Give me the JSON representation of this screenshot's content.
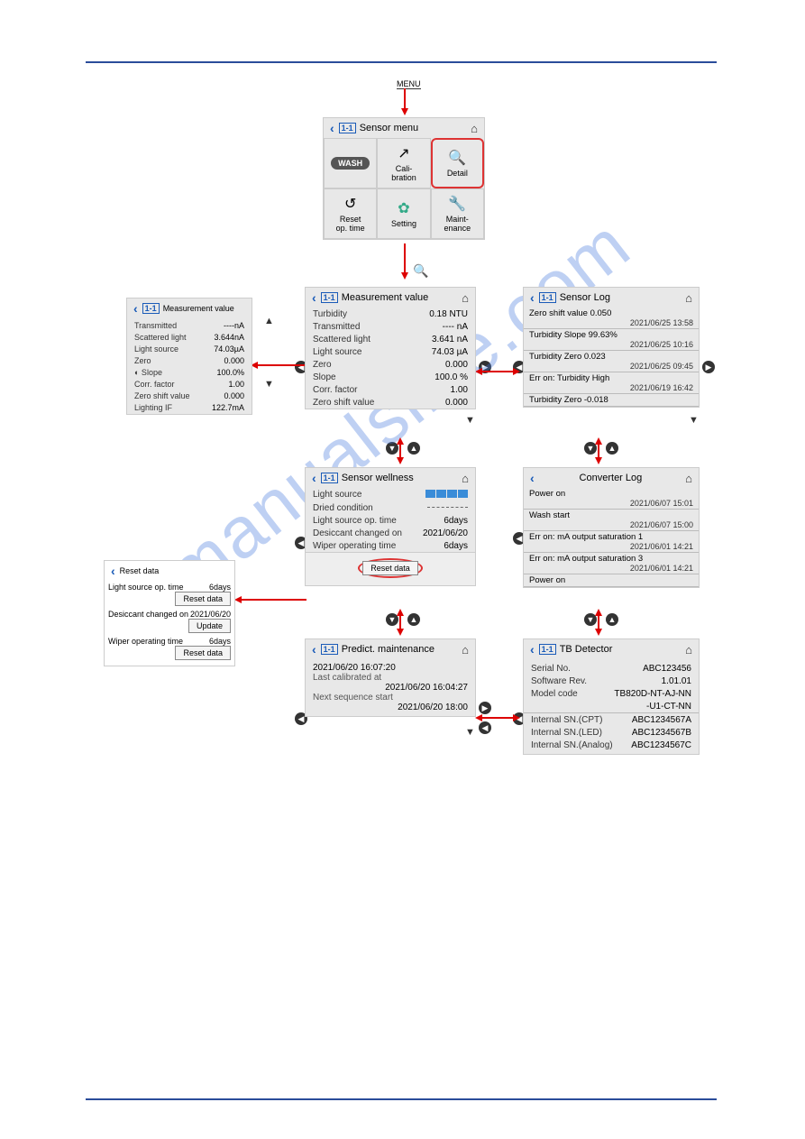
{
  "watermark": "manualslive.com",
  "menu_label": "MENU",
  "panels": {
    "sensor_menu": {
      "tag": "1-1",
      "title": "Sensor menu",
      "cells": [
        "WASH",
        "Cali-\nbration",
        "Detail",
        "Reset\nop. time",
        "Setting",
        "Maint-\nenance"
      ]
    },
    "meas_small": {
      "tag": "1-1",
      "title": "Measurement value",
      "rows": [
        {
          "k": "Transmitted",
          "v": "----nA"
        },
        {
          "k": "Scattered light",
          "v": "3.644nA"
        },
        {
          "k": "Light source",
          "v": "74.03µA"
        },
        {
          "k": "Zero",
          "v": "0.000"
        },
        {
          "k": "Slope",
          "v": "100.0%"
        },
        {
          "k": "Corr. factor",
          "v": "1.00"
        },
        {
          "k": "Zero shift value",
          "v": "0.000"
        },
        {
          "k": "Lighting IF",
          "v": "122.7mA"
        }
      ]
    },
    "meas": {
      "tag": "1-1",
      "title": "Measurement value",
      "rows": [
        {
          "k": "Turbidity",
          "v": "0.18 NTU"
        },
        {
          "k": "Transmitted",
          "v": "---- nA"
        },
        {
          "k": "Scattered light",
          "v": "3.641 nA"
        },
        {
          "k": "Light source",
          "v": "74.03 µA"
        },
        {
          "k": "Zero",
          "v": "0.000"
        },
        {
          "k": "Slope",
          "v": "100.0 %"
        },
        {
          "k": "Corr. factor",
          "v": "1.00"
        },
        {
          "k": "Zero shift value",
          "v": "0.000"
        }
      ]
    },
    "sensor_log": {
      "tag": "1-1",
      "title": "Sensor Log",
      "entries": [
        {
          "t": "Zero shift value 0.050",
          "d": "2021/06/25 13:58"
        },
        {
          "t": "Turbidity Slope 99.63%",
          "d": "2021/06/25 10:16"
        },
        {
          "t": "Turbidity Zero 0.023",
          "d": "2021/06/25 09:45"
        },
        {
          "t": "Err on: Turbidity High",
          "d": "2021/06/19 16:42"
        },
        {
          "t": "Turbidity Zero -0.018",
          "d": ""
        }
      ]
    },
    "wellness": {
      "tag": "1-1",
      "title": "Sensor wellness",
      "rows": [
        {
          "k": "Light source",
          "v": "BARS"
        },
        {
          "k": "Dried condition",
          "v": "DASH"
        },
        {
          "k": "Light source op. time",
          "v": "6days"
        },
        {
          "k": "Desiccant changed on",
          "v": "2021/06/20"
        },
        {
          "k": "Wiper operating time",
          "v": "6days"
        }
      ],
      "reset": "Reset data"
    },
    "converter_log": {
      "title": "Converter Log",
      "entries": [
        {
          "t": "Power on",
          "d": "2021/06/07 15:01"
        },
        {
          "t": "Wash start",
          "d": "2021/06/07 15:00"
        },
        {
          "t": "Err on: mA output saturation 1",
          "d": "2021/06/01 14:21"
        },
        {
          "t": "Err on: mA output saturation 3",
          "d": "2021/06/01 14:21"
        },
        {
          "t": "Power on",
          "d": ""
        }
      ]
    },
    "reset_data": {
      "title": "Reset data",
      "rows": [
        {
          "k": "Light source op. time",
          "v": "6days",
          "btn": "Reset data"
        },
        {
          "k": "Desiccant changed on",
          "v": "2021/06/20",
          "btn": "Update"
        },
        {
          "k": "Wiper operating time",
          "v": "6days",
          "btn": "Reset data"
        }
      ]
    },
    "predict": {
      "tag": "1-1",
      "title": "Predict. maintenance",
      "lines": [
        "2021/06/20 16:07:20",
        "Last calibrated at",
        "2021/06/20 16:04:27",
        "Next sequence start",
        "2021/06/20 18:00"
      ]
    },
    "tb_detector": {
      "tag": "1-1",
      "title": "TB Detector",
      "rows": [
        {
          "k": "Serial No.",
          "v": "ABC123456"
        },
        {
          "k": "Software Rev.",
          "v": "1.01.01"
        },
        {
          "k": "Model code",
          "v": "TB820D-NT-AJ-NN"
        },
        {
          "k": "",
          "v": "-U1-CT-NN"
        },
        {
          "k": "Internal SN.(CPT)",
          "v": "ABC1234567A"
        },
        {
          "k": "Internal SN.(LED)",
          "v": "ABC1234567B"
        },
        {
          "k": "Internal SN.(Analog)",
          "v": "ABC1234567C"
        }
      ]
    }
  }
}
